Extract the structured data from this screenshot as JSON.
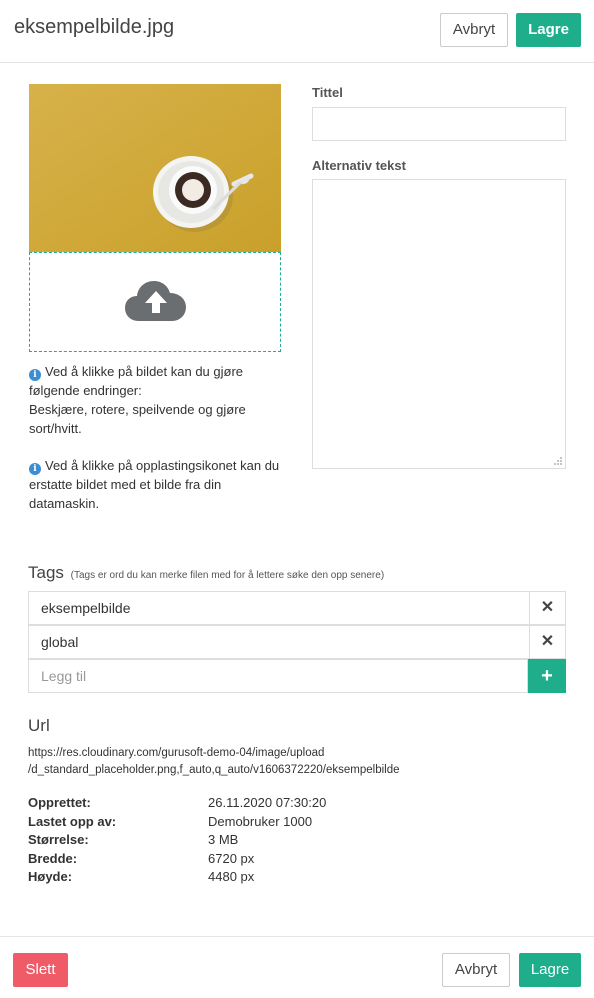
{
  "header": {
    "title": "eksempelbilde.jpg",
    "cancel_label": "Avbryt",
    "save_label": "Lagre"
  },
  "form": {
    "title_label": "Tittel",
    "title_value": "",
    "alt_label": "Alternativ tekst",
    "alt_value": ""
  },
  "info": {
    "crop_text": "Ved å klikke på bildet kan du gjøre følgende endringer:\nBeskjære, rotere, speilvende og gjøre sort/hvitt.",
    "upload_text": "Ved å klikke på opplastingsikonet kan du erstatte bildet med et bilde fra din datamaskin."
  },
  "tags": {
    "title": "Tags",
    "hint": "(Tags er ord du kan merke filen med for å lettere søke den opp senere)",
    "items": [
      "eksempelbilde",
      "global"
    ],
    "remove_symbol": "✕",
    "add_placeholder": "Legg til",
    "add_symbol": "+"
  },
  "url": {
    "title": "Url",
    "line1": "https://res.cloudinary.com/gurusoft-demo-04/image/upload",
    "line2": "/d_standard_placeholder.png,f_auto,q_auto/v1606372220/eksempelbilde"
  },
  "meta": [
    {
      "key": "Opprettet:",
      "value": "26.11.2020 07:30:20"
    },
    {
      "key": "Lastet opp av:",
      "value": "Demobruker 1000"
    },
    {
      "key": "Størrelse:",
      "value": "3 MB"
    },
    {
      "key": "Bredde:",
      "value": "6720 px"
    },
    {
      "key": "Høyde:",
      "value": "4480 px"
    }
  ],
  "footer": {
    "delete_label": "Slett",
    "cancel_label": "Avbryt",
    "save_label": "Lagre"
  },
  "colors": {
    "primary": "#1eae8b",
    "danger": "#ef5c68",
    "info_icon": "#3a8ed1",
    "image_background": "#d3ac37"
  }
}
